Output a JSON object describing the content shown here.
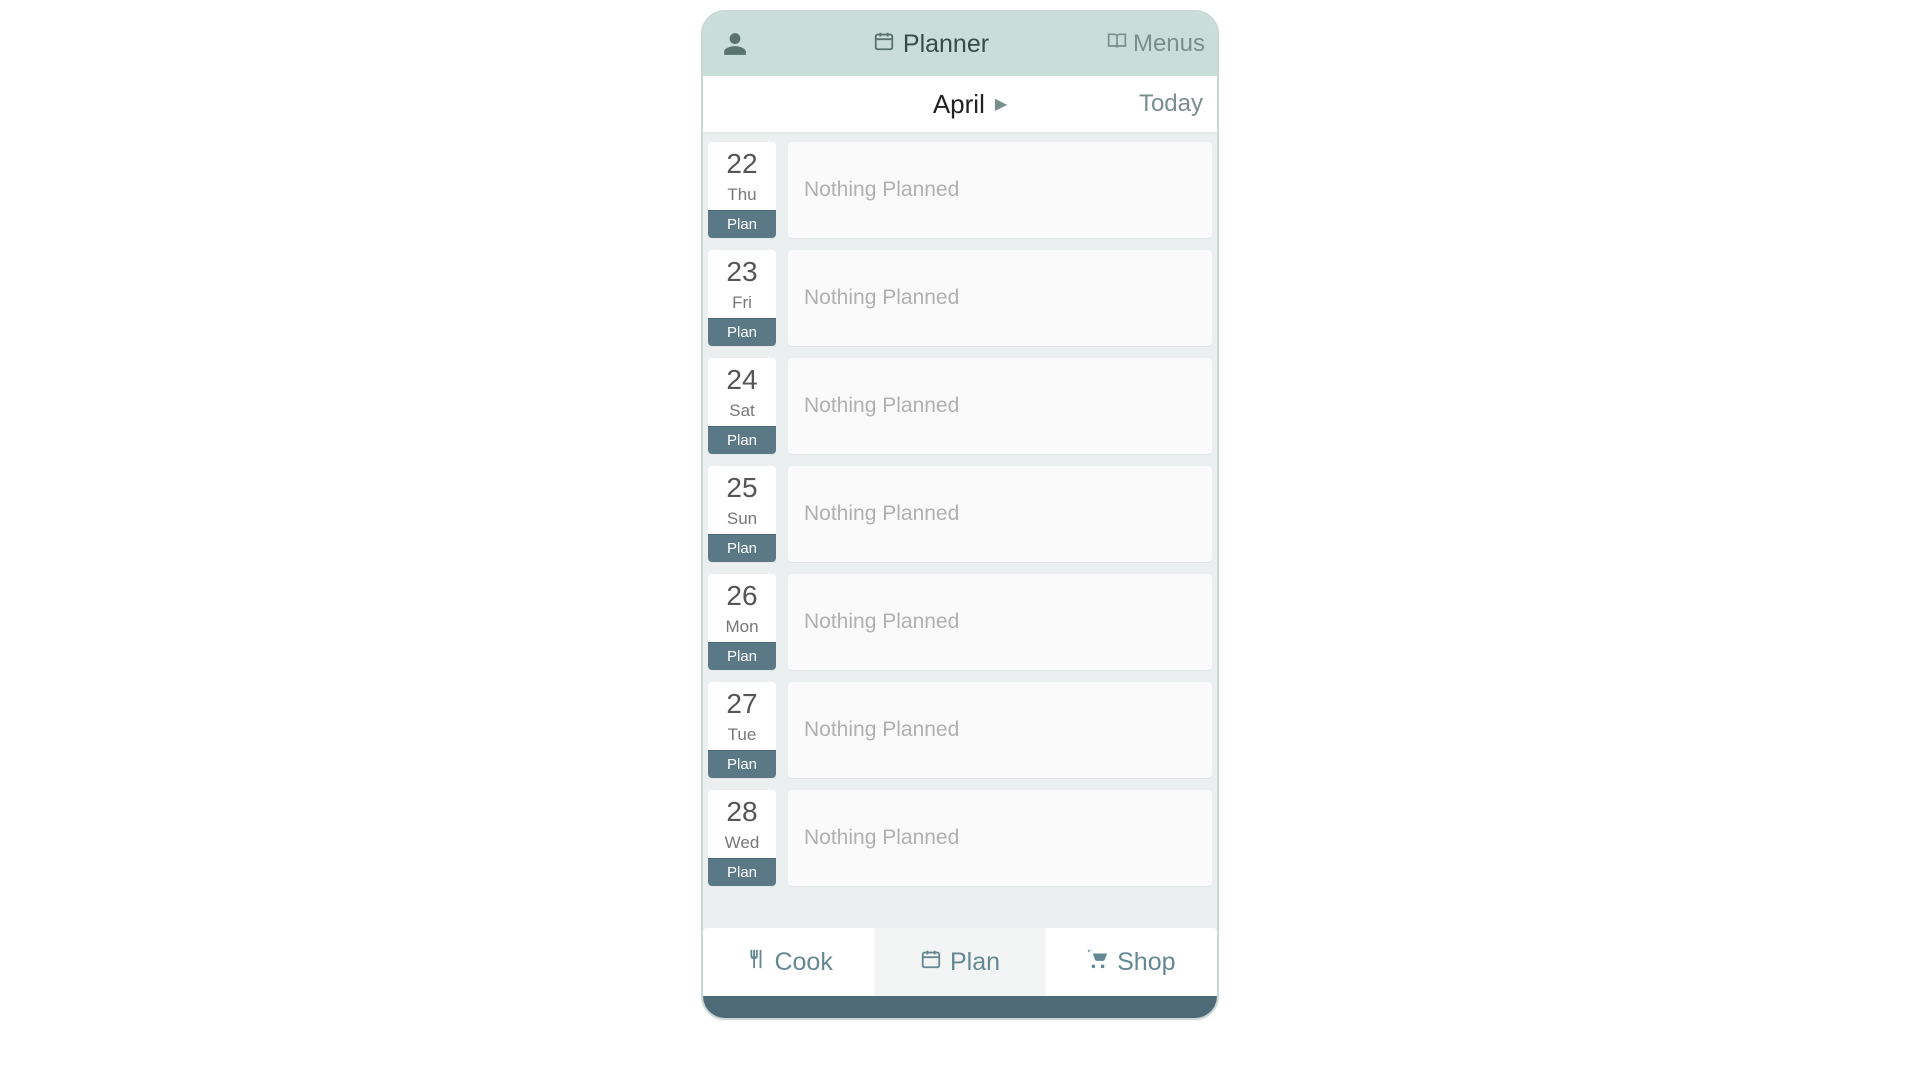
{
  "header": {
    "title": "Planner",
    "menus_label": "Menus"
  },
  "month_bar": {
    "month": "April",
    "today_label": "Today"
  },
  "days": [
    {
      "number": "22",
      "name": "Thu",
      "plan_label": "Plan",
      "content": "Nothing Planned"
    },
    {
      "number": "23",
      "name": "Fri",
      "plan_label": "Plan",
      "content": "Nothing Planned"
    },
    {
      "number": "24",
      "name": "Sat",
      "plan_label": "Plan",
      "content": "Nothing Planned"
    },
    {
      "number": "25",
      "name": "Sun",
      "plan_label": "Plan",
      "content": "Nothing Planned"
    },
    {
      "number": "26",
      "name": "Mon",
      "plan_label": "Plan",
      "content": "Nothing Planned"
    },
    {
      "number": "27",
      "name": "Tue",
      "plan_label": "Plan",
      "content": "Nothing Planned"
    },
    {
      "number": "28",
      "name": "Wed",
      "plan_label": "Plan",
      "content": "Nothing Planned"
    }
  ],
  "bottom_nav": {
    "cook": "Cook",
    "plan": "Plan",
    "shop": "Shop"
  }
}
